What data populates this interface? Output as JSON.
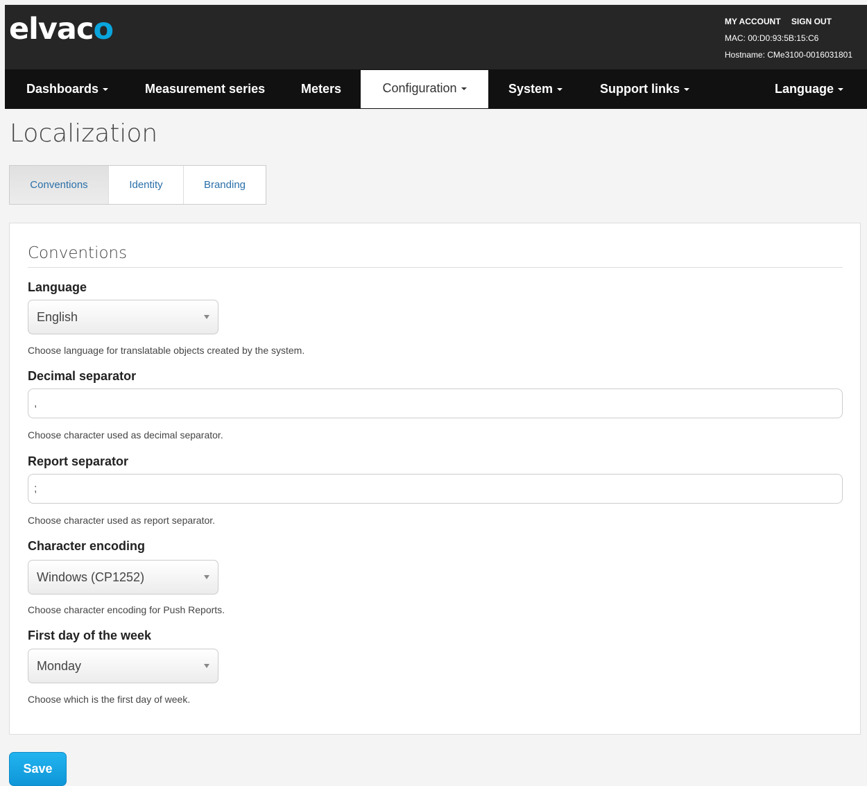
{
  "header": {
    "logo_text_main": "elvac",
    "logo_text_accent": "o",
    "my_account": "MY ACCOUNT",
    "sign_out": "SIGN OUT",
    "mac": "MAC: 00:D0:93:5B:15:C6",
    "hostname": "Hostname: CMe3100-0016031801"
  },
  "nav": {
    "dashboards": "Dashboards",
    "measurement_series": "Measurement series",
    "meters": "Meters",
    "configuration": "Configuration",
    "system": "System",
    "support_links": "Support links",
    "language": "Language"
  },
  "page_title": "Localization",
  "tabs": {
    "conventions": "Conventions",
    "identity": "Identity",
    "branding": "Branding",
    "active": "Conventions"
  },
  "form": {
    "section_title": "Conventions",
    "language": {
      "label": "Language",
      "value": "English",
      "help": "Choose language for translatable objects created by the system."
    },
    "decimal_separator": {
      "label": "Decimal separator",
      "value": ",",
      "help": "Choose character used as decimal separator."
    },
    "report_separator": {
      "label": "Report separator",
      "value": ";",
      "help": "Choose character used as report separator."
    },
    "character_encoding": {
      "label": "Character encoding",
      "value": "Windows (CP1252)",
      "help": "Choose character encoding for Push Reports."
    },
    "first_day": {
      "label": "First day of the week",
      "value": "Monday",
      "help": "Choose which is the first day of week."
    }
  },
  "save_label": "Save",
  "colors": {
    "header_bg": "#262626",
    "navbar_bg": "#111111",
    "brand_accent": "#0aa5dc",
    "link_blue": "#2a6fa8",
    "save_button": "#1aa3e0"
  }
}
